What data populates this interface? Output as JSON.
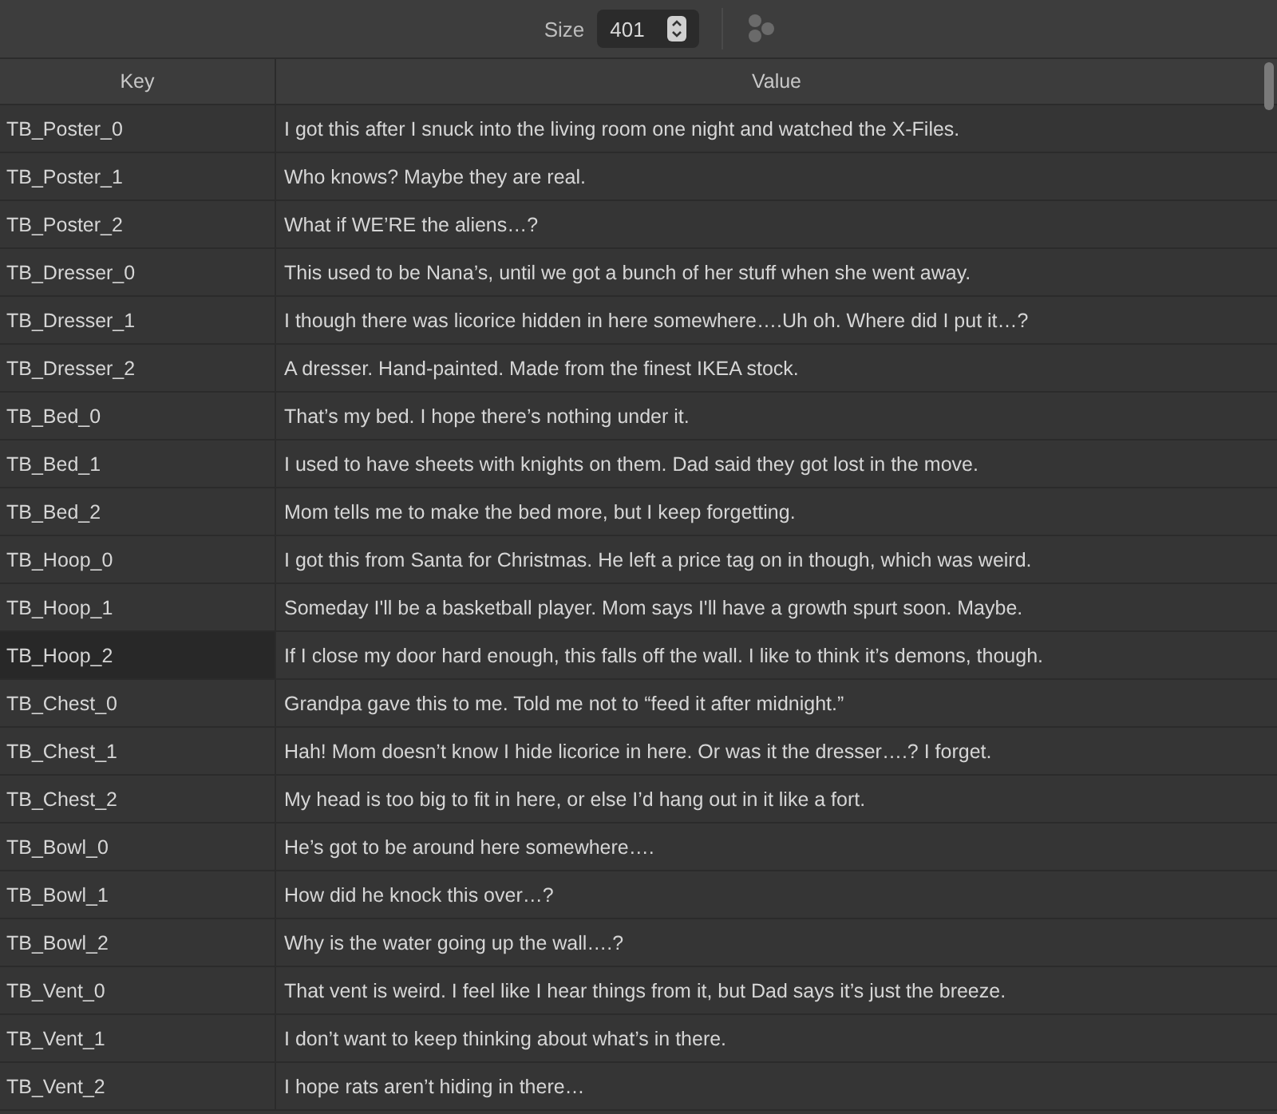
{
  "toolbar": {
    "size_label": "Size",
    "size_value": "401"
  },
  "table": {
    "columns": [
      "Key",
      "Value"
    ],
    "rows": [
      {
        "key": "TB_Poster_0",
        "value": "I got this after I snuck into the living room one night and watched the X-Files.",
        "selected": false
      },
      {
        "key": "TB_Poster_1",
        "value": "Who knows? Maybe they are real.",
        "selected": false
      },
      {
        "key": "TB_Poster_2",
        "value": "What if WE’RE the aliens…?",
        "selected": false
      },
      {
        "key": "TB_Dresser_0",
        "value": "This used to be Nana’s, until we got a bunch of her stuff when she went away.",
        "selected": false
      },
      {
        "key": "TB_Dresser_1",
        "value": "I though there was licorice hidden in here somewhere….Uh oh. Where did I put it…?",
        "selected": false
      },
      {
        "key": "TB_Dresser_2",
        "value": "A dresser. Hand-painted. Made from the finest IKEA stock.",
        "selected": false
      },
      {
        "key": "TB_Bed_0",
        "value": "That’s my bed. I hope there’s nothing under it.",
        "selected": false
      },
      {
        "key": "TB_Bed_1",
        "value": "I used to have sheets with knights on them. Dad said they got lost in the move.",
        "selected": false
      },
      {
        "key": "TB_Bed_2",
        "value": "Mom tells me to make the bed more, but I keep forgetting.",
        "selected": false
      },
      {
        "key": "TB_Hoop_0",
        "value": "I got this from Santa for Christmas. He left a price tag on in though, which was weird.",
        "selected": false
      },
      {
        "key": "TB_Hoop_1",
        "value": "Someday I'll be a basketball player. Mom says I'll have a growth spurt soon. Maybe.",
        "selected": false
      },
      {
        "key": "TB_Hoop_2",
        "value": "If I close my door hard enough, this falls off the wall. I like to think it’s demons, though.",
        "selected": true
      },
      {
        "key": "TB_Chest_0",
        "value": "Grandpa gave this to me. Told me not to “feed it after midnight.”",
        "selected": false
      },
      {
        "key": "TB_Chest_1",
        "value": "Hah! Mom doesn’t know I hide licorice in here. Or was it the dresser….? I forget.",
        "selected": false
      },
      {
        "key": "TB_Chest_2",
        "value": "My head is too big to fit in here, or else I’d hang out in it like a fort.",
        "selected": false
      },
      {
        "key": "TB_Bowl_0",
        "value": "He’s got to be around here somewhere….",
        "selected": false
      },
      {
        "key": "TB_Bowl_1",
        "value": "How did he knock this over…?",
        "selected": false
      },
      {
        "key": "TB_Bowl_2",
        "value": "Why is the water going up the wall….?",
        "selected": false
      },
      {
        "key": "TB_Vent_0",
        "value": "That vent is weird. I feel like I hear things from it, but Dad says it’s just the breeze.",
        "selected": false
      },
      {
        "key": "TB_Vent_1",
        "value": "I don’t want to keep thinking about what’s in there.",
        "selected": false
      },
      {
        "key": "TB_Vent_2",
        "value": "I hope rats aren’t hiding in there…",
        "selected": false
      }
    ]
  }
}
